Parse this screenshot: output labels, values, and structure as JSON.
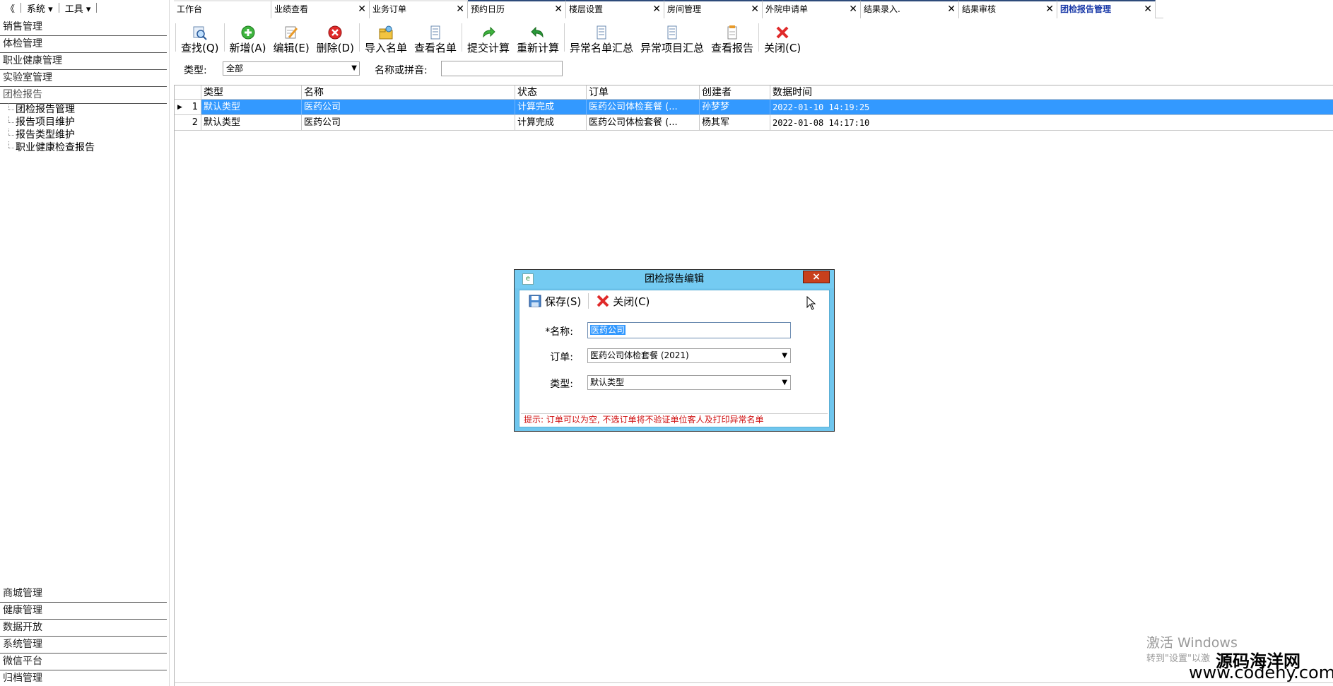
{
  "sys_menu": {
    "collapse": "《",
    "system": "系统 ▾",
    "tools": "工具 ▾"
  },
  "sidebar": {
    "groups_top": [
      {
        "label": "销售管理"
      },
      {
        "label": "体检管理"
      },
      {
        "label": "职业健康管理"
      },
      {
        "label": "实验室管理"
      },
      {
        "label": "团检报告"
      }
    ],
    "tree": [
      {
        "label": "团检报告管理"
      },
      {
        "label": "报告项目维护"
      },
      {
        "label": "报告类型维护"
      },
      {
        "label": "职业健康检查报告"
      }
    ],
    "groups_bottom": [
      {
        "label": "商城管理"
      },
      {
        "label": "健康管理"
      },
      {
        "label": "数据开放"
      },
      {
        "label": "系统管理"
      },
      {
        "label": "微信平台"
      },
      {
        "label": "归档管理"
      }
    ]
  },
  "tabs": [
    {
      "label": "工作台"
    },
    {
      "label": "业绩查看"
    },
    {
      "label": "业务订单"
    },
    {
      "label": "预约日历"
    },
    {
      "label": "楼层设置"
    },
    {
      "label": "房间管理"
    },
    {
      "label": "外院申请单"
    },
    {
      "label": "结果录入."
    },
    {
      "label": "结果审核"
    },
    {
      "label": "团检报告管理"
    }
  ],
  "toolbar": {
    "search": "查找(Q)",
    "add": "新增(A)",
    "edit": "编辑(E)",
    "delete": "删除(D)",
    "import_list": "导入名单",
    "view_list": "查看名单",
    "submit_calc": "提交计算",
    "recalc": "重新计算",
    "abnormal_list": "异常名单汇总",
    "abnormal_items": "异常项目汇总",
    "view_report": "查看报告",
    "close": "关闭(C)"
  },
  "filter": {
    "type_label": "类型:",
    "type_value": "全部",
    "name_label": "名称或拼音:",
    "name_value": ""
  },
  "grid": {
    "columns": [
      "类型",
      "名称",
      "状态",
      "订单",
      "创建者",
      "数据时间"
    ],
    "rows": [
      {
        "no": "1",
        "type": "默认类型",
        "name": "医药公司",
        "status": "计算完成",
        "order": "医药公司体检套餐 (...",
        "creator": "孙梦梦",
        "time": "2022-01-10 14:19:25"
      },
      {
        "no": "2",
        "type": "默认类型",
        "name": "医药公司",
        "status": "计算完成",
        "order": "医药公司体检套餐 (...",
        "creator": "杨其军",
        "time": "2022-01-08 14:17:10"
      }
    ]
  },
  "dialog": {
    "title": "团检报告编辑",
    "close_x": "×",
    "save": "保存(S)",
    "close": "关闭(C)",
    "name_label": "*名称:",
    "name_value": "医药公司",
    "order_label": "订单:",
    "order_value": "医药公司体检套餐 (2021)",
    "type_label": "类型:",
    "type_value": "默认类型",
    "hint": "提示: 订单可以为空, 不选订单将不验证单位客人及打印异常名单"
  },
  "watermark": {
    "line1": "激活 Windows",
    "line2": "转到\"设置\"以激",
    "brand_cn": "源码海洋网",
    "brand_url": "www.codehy.com"
  },
  "colors": {
    "selection": "#3399ff",
    "dialog_frame": "#6fc6ee",
    "close_red": "#c8401c",
    "active_tab": "#1a3aa8",
    "hint_red": "#d01010"
  }
}
